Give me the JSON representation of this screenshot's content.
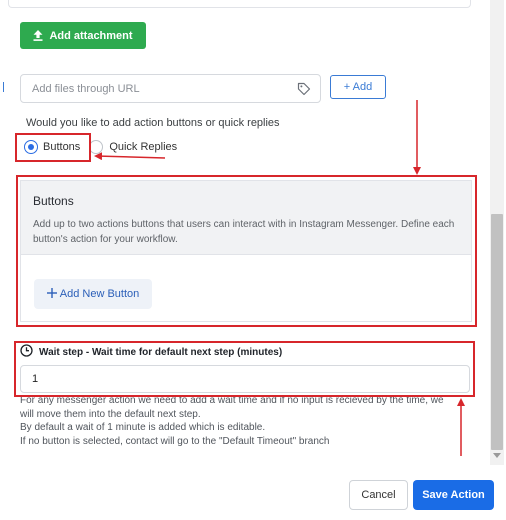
{
  "attachment": {
    "add_attachment_label": "Add attachment",
    "url_placeholder": "Add files through URL",
    "add_button_label": "+ Add",
    "icons": {
      "upload": "upload-icon",
      "tag": "tag-icon"
    }
  },
  "action_choice": {
    "question": "Would you like to add action buttons or quick replies",
    "options": [
      {
        "label": "Buttons",
        "selected": true
      },
      {
        "label": "Quick Replies",
        "selected": false
      }
    ]
  },
  "buttons_section": {
    "title": "Buttons",
    "description": "Add up to two actions buttons that users can interact with in Instagram Messenger. Define each button's action for your workflow.",
    "add_new_button_label": "Add New Button"
  },
  "wait_step": {
    "label": "Wait step - Wait time for default next step (minutes)",
    "value": "1",
    "help_lines": [
      "For any messenger action we need to add a wait time and if no input is recieved by the time, we will move them into the default next step.",
      "By default a wait of 1 minute is added which is editable.",
      "If no button is selected, contact will go to the \"Default Timeout\" branch"
    ]
  },
  "footer": {
    "cancel_label": "Cancel",
    "save_label": "Save Action"
  },
  "colors": {
    "primary_blue": "#1a6ce6",
    "green": "#2eaa4f",
    "annotation_red": "#d7262b"
  }
}
